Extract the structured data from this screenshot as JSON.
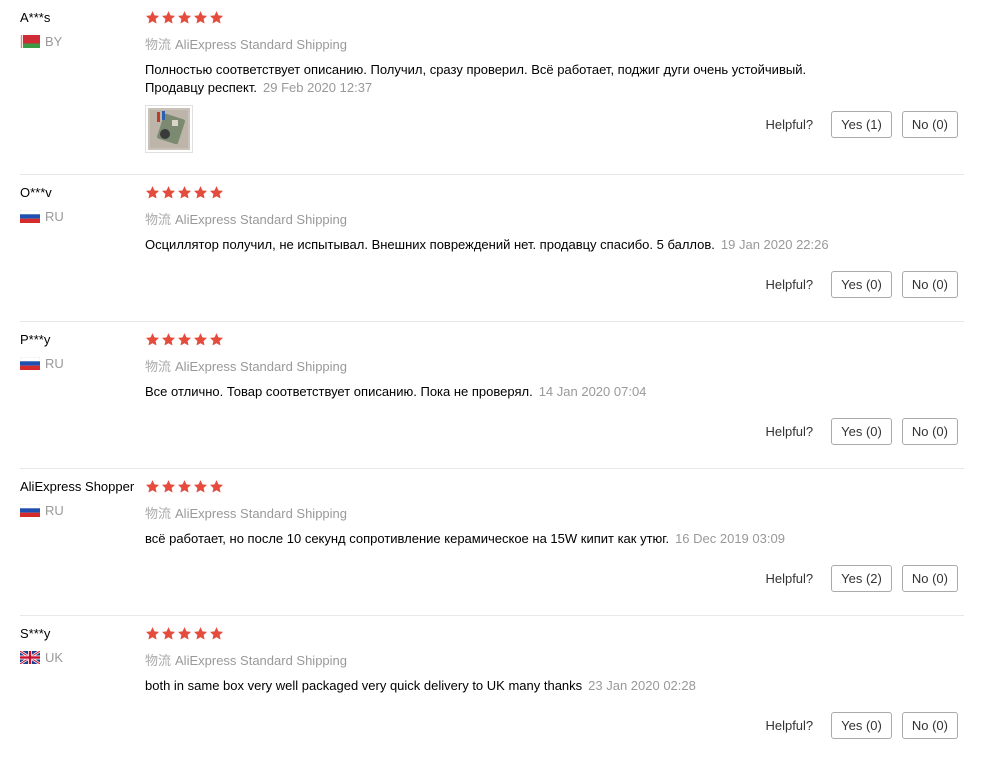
{
  "colors": {
    "star": "#e64c3c",
    "muted": "#999999",
    "divider": "#e8e8e8"
  },
  "reviews": [
    {
      "user": "A***s",
      "country": "BY",
      "flag_icon": "belarus-flag",
      "rating": 5,
      "logistics_label": "物流",
      "shipping": "AliExpress Standard Shipping",
      "text_line1": "Полностью соответствует описанию. Получил, сразу проверил. Всё работает, поджиг дуги очень устойчивый.",
      "text_line2": "Продавцу респект.",
      "date": "29 Feb 2020 12:37",
      "has_photo": true,
      "helpful_label": "Helpful?",
      "yes_label": "Yes (1)",
      "no_label": "No (0)"
    },
    {
      "user": "O***v",
      "country": "RU",
      "flag_icon": "russia-flag",
      "rating": 5,
      "logistics_label": "物流",
      "shipping": "AliExpress Standard Shipping",
      "text": "Осциллятор получил, не испытывал. Внешних повреждений нет. продавцу спасибо. 5 баллов.",
      "date": "19 Jan 2020 22:26",
      "helpful_label": "Helpful?",
      "yes_label": "Yes (0)",
      "no_label": "No (0)"
    },
    {
      "user": "P***y",
      "country": "RU",
      "flag_icon": "russia-flag",
      "rating": 5,
      "logistics_label": "物流",
      "shipping": "AliExpress Standard Shipping",
      "text": "Все отлично. Товар соответствует описанию. Пока не проверял.",
      "date": "14 Jan 2020 07:04",
      "helpful_label": "Helpful?",
      "yes_label": "Yes (0)",
      "no_label": "No (0)"
    },
    {
      "user": "AliExpress Shopper",
      "country": "RU",
      "flag_icon": "russia-flag",
      "rating": 5,
      "logistics_label": "物流",
      "shipping": "AliExpress Standard Shipping",
      "text": "всё работает, но после 10 секунд сопротивление керамическое на 15W кипит как утюг.",
      "date": "16 Dec 2019 03:09",
      "helpful_label": "Helpful?",
      "yes_label": "Yes (2)",
      "no_label": "No (0)"
    },
    {
      "user": "S***y",
      "country": "UK",
      "flag_icon": "uk-flag",
      "rating": 5,
      "logistics_label": "物流",
      "shipping": "AliExpress Standard Shipping",
      "text": "both in same box very well packaged very quick delivery to UK many thanks",
      "date": "23 Jan 2020 02:28",
      "helpful_label": "Helpful?",
      "yes_label": "Yes (0)",
      "no_label": "No (0)"
    }
  ]
}
